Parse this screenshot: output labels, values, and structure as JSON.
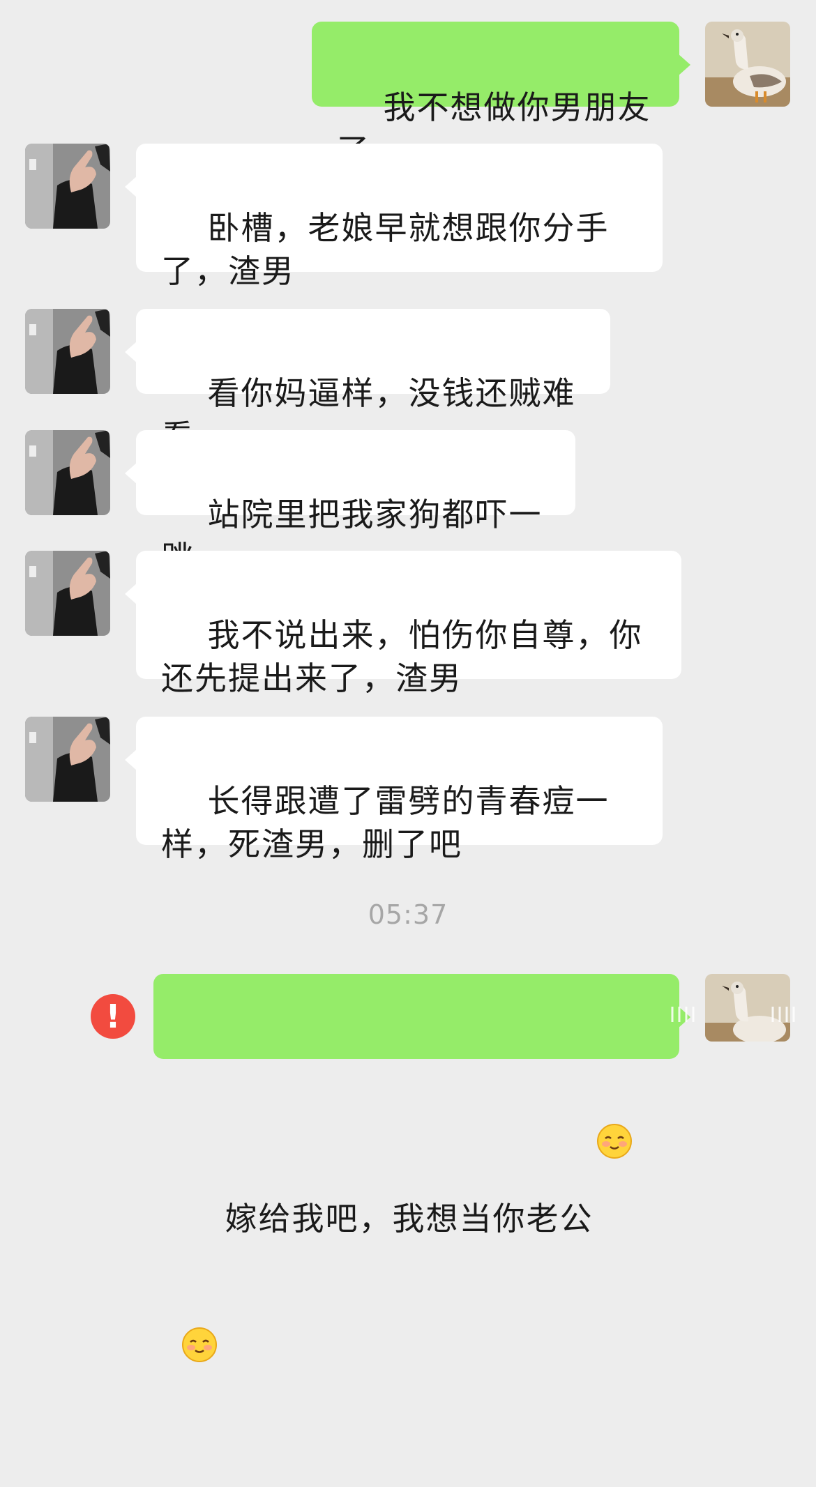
{
  "chat": {
    "messages": [
      {
        "sender": "me",
        "text": "我不想做你男朋友了"
      },
      {
        "sender": "other",
        "text": "卧槽，老娘早就想跟你分手了，渣男"
      },
      {
        "sender": "other",
        "text": "看你妈逼样，没钱还贼难看"
      },
      {
        "sender": "other",
        "text": "站院里把我家狗都吓一跳"
      },
      {
        "sender": "other",
        "text": "我不说出来，怕伤你自尊，你还先提出来了，渣男"
      },
      {
        "sender": "other",
        "text": "长得跟遭了雷劈的青春痘一样，死渣男，删了吧"
      },
      {
        "sender": "me",
        "text": "嫁给我吧，我想当你老公",
        "emoji": [
          "blush-smile-emoji",
          "blush-smile-emoji"
        ],
        "status": "send-failed"
      }
    ],
    "timestamp": "05:37"
  },
  "status": {
    "alert_glyph": "!"
  },
  "colors": {
    "background": "#ededed",
    "outgoing_bubble": "#95ec69",
    "incoming_bubble": "#ffffff",
    "error_red": "#f24b3f",
    "timestamp_text": "#a6a6a6"
  },
  "icons": {
    "my_avatar": "goose-photo-avatar",
    "other_avatar": "hand-gesture-photo-avatar",
    "error": "exclamation-circle-icon",
    "emoji": "blush-smile-emoji"
  }
}
